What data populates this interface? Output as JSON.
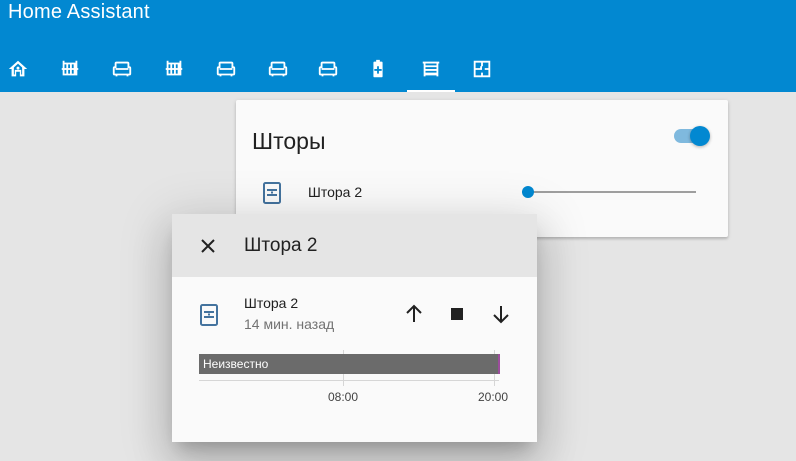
{
  "app": {
    "title": "Home Assistant"
  },
  "tabs": [
    {
      "icon": "home-group-icon",
      "active": false
    },
    {
      "icon": "radiator-icon",
      "active": false
    },
    {
      "icon": "sofa-icon",
      "active": false
    },
    {
      "icon": "radiator-icon",
      "active": false
    },
    {
      "icon": "sofa-icon",
      "active": false
    },
    {
      "icon": "sofa-icon",
      "active": false
    },
    {
      "icon": "sofa-icon",
      "active": false
    },
    {
      "icon": "battery-icon",
      "active": false
    },
    {
      "icon": "blinds-icon",
      "active": true
    },
    {
      "icon": "floor-plan-icon",
      "active": false
    }
  ],
  "card": {
    "title": "Шторы",
    "toggle_on": true,
    "entity": {
      "name": "Штора 2",
      "icon": "window-shutter-icon",
      "position_percent": 0
    }
  },
  "dialog": {
    "title": "Штора 2",
    "entity": {
      "name": "Штора 2",
      "last_changed": "14 мин. назад",
      "icon": "window-shutter-icon"
    },
    "controls": [
      "arrow-up-icon",
      "stop-icon",
      "arrow-down-icon"
    ],
    "history": {
      "state_label": "Неизвестно",
      "ticks": [
        "08:00",
        "20:00"
      ]
    }
  },
  "colors": {
    "accent": "#0288d1",
    "header_bg": "#0288d1",
    "icon_color": "#44739e",
    "history_bar": "#6b6b6b"
  }
}
